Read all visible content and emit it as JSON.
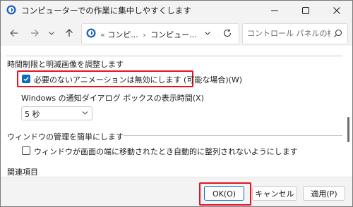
{
  "window": {
    "title": "コンピューターでの作業に集中しやすくします"
  },
  "address": {
    "sep": "«",
    "crumb1": "コンピ...",
    "crumb2": "コンピュー..."
  },
  "search": {
    "placeholder": "コントロール パネルの検索"
  },
  "sections": {
    "time_limits": {
      "title": "時間制限と明滅画像を調整します",
      "disable_animations_label": "必要のないアニメーションは無効にします (可能な場合)(W)",
      "disable_animations_checked": true,
      "notification_label": "Windows の通知ダイアログ ボックスの表示時間(X)",
      "notification_value": "5 秒"
    },
    "window_management": {
      "title": "ウィンドウの管理を簡単にします",
      "prevent_arrange_label": "ウィンドウが画面の端に移動されたとき自動的に整列されないようにします",
      "prevent_arrange_checked": false
    },
    "related": {
      "title": "関連項目"
    }
  },
  "buttons": {
    "ok": "OK(O)",
    "cancel": "キャンセル",
    "apply": "適用(P)"
  },
  "colors": {
    "highlight": "#e81123",
    "accent": "#0f6cbd"
  }
}
